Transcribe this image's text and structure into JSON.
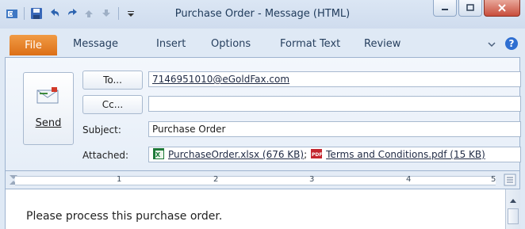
{
  "window": {
    "title": "Purchase Order - Message (HTML)",
    "accent": "#e0711c"
  },
  "quick_access": [
    {
      "name": "outlook-icon"
    },
    {
      "name": "save-icon"
    },
    {
      "name": "undo-icon"
    },
    {
      "name": "redo-icon"
    },
    {
      "name": "up-icon"
    },
    {
      "name": "down-icon"
    },
    {
      "name": "customize-icon"
    }
  ],
  "tabs": {
    "file": "File",
    "items": [
      "Message",
      "Insert",
      "Options",
      "Format Text",
      "Review"
    ]
  },
  "compose": {
    "send_label": "Send",
    "to_button": "To...",
    "cc_button": "Cc...",
    "to_value": "7146951010@eGoldFax.com",
    "cc_value": "",
    "subject_label": "Subject:",
    "subject_value": "Purchase Order",
    "attached_label": "Attached:",
    "attachments": [
      {
        "name": "PurchaseOrder.xlsx (676 KB)",
        "icon": "excel-icon"
      },
      {
        "name": "Terms and Conditions.pdf (15 KB)",
        "icon": "pdf-icon"
      }
    ],
    "attachment_separator": ";"
  },
  "ruler": {
    "numbers": [
      "1",
      "2",
      "3",
      "4",
      "5"
    ]
  },
  "body": {
    "text": "Please process this purchase order."
  }
}
